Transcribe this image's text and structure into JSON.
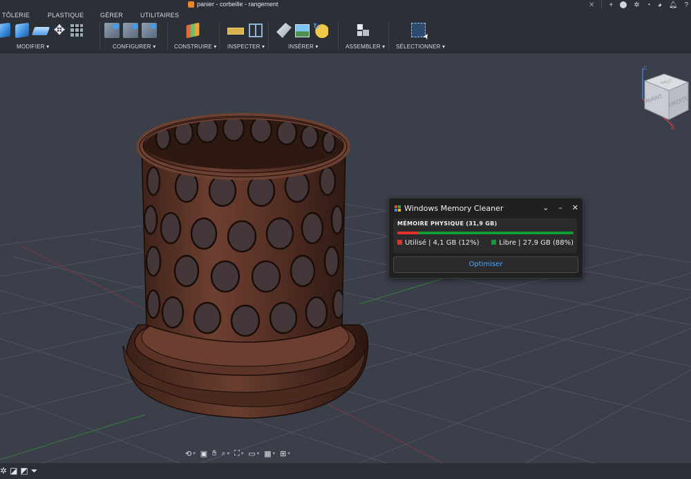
{
  "window": {
    "title": "panier - corbeille - rangement"
  },
  "ribbon": {
    "tabs": [
      "TÔLERIE",
      "PLASTIQUE",
      "GÉRER",
      "UTILITAIRES"
    ],
    "groups": {
      "modifier": "MODIFIER ▾",
      "configurer": "CONFIGURER ▾",
      "construire": "CONSTRUIRE ▾",
      "inspecter": "INSPECTER ▾",
      "inserer": "INSÉRER ▾",
      "assembler": "ASSEMBLER ▾",
      "selectionner": "SÉLECTIONNER ▾"
    }
  },
  "viewcube": {
    "top": "HAUT",
    "front": "AVANT",
    "right": "DROITE",
    "axis_z": "Z",
    "axis_x": "X"
  },
  "memory_cleaner": {
    "title": "Windows Memory Cleaner",
    "section": "MÉMOIRE PHYSIQUE (31,9 GB)",
    "used_label": "Utilisé | 4,1 GB (12%)",
    "free_label": "Libre | 27,9 GB (88%)",
    "used_fraction": 0.12,
    "used_color": "#e0342a",
    "free_color": "#0f9d38",
    "button": "Optimiser"
  },
  "colors": {
    "background": "#3a3f4a",
    "ribbon": "#2b2f36",
    "model": "#5a3328",
    "accent_blue": "#4aa8ff"
  },
  "icons": {
    "titlebar": [
      "add-icon",
      "help-circle-icon",
      "loading-icon",
      "refresh-icon",
      "notifications-icon",
      "bell-icon",
      "help-icon"
    ],
    "navigation": [
      "orbit-icon",
      "look-at-icon",
      "pan-icon",
      "zoom-icon",
      "fit-icon",
      "display-icon",
      "grid-icon",
      "viewports-icon"
    ]
  }
}
